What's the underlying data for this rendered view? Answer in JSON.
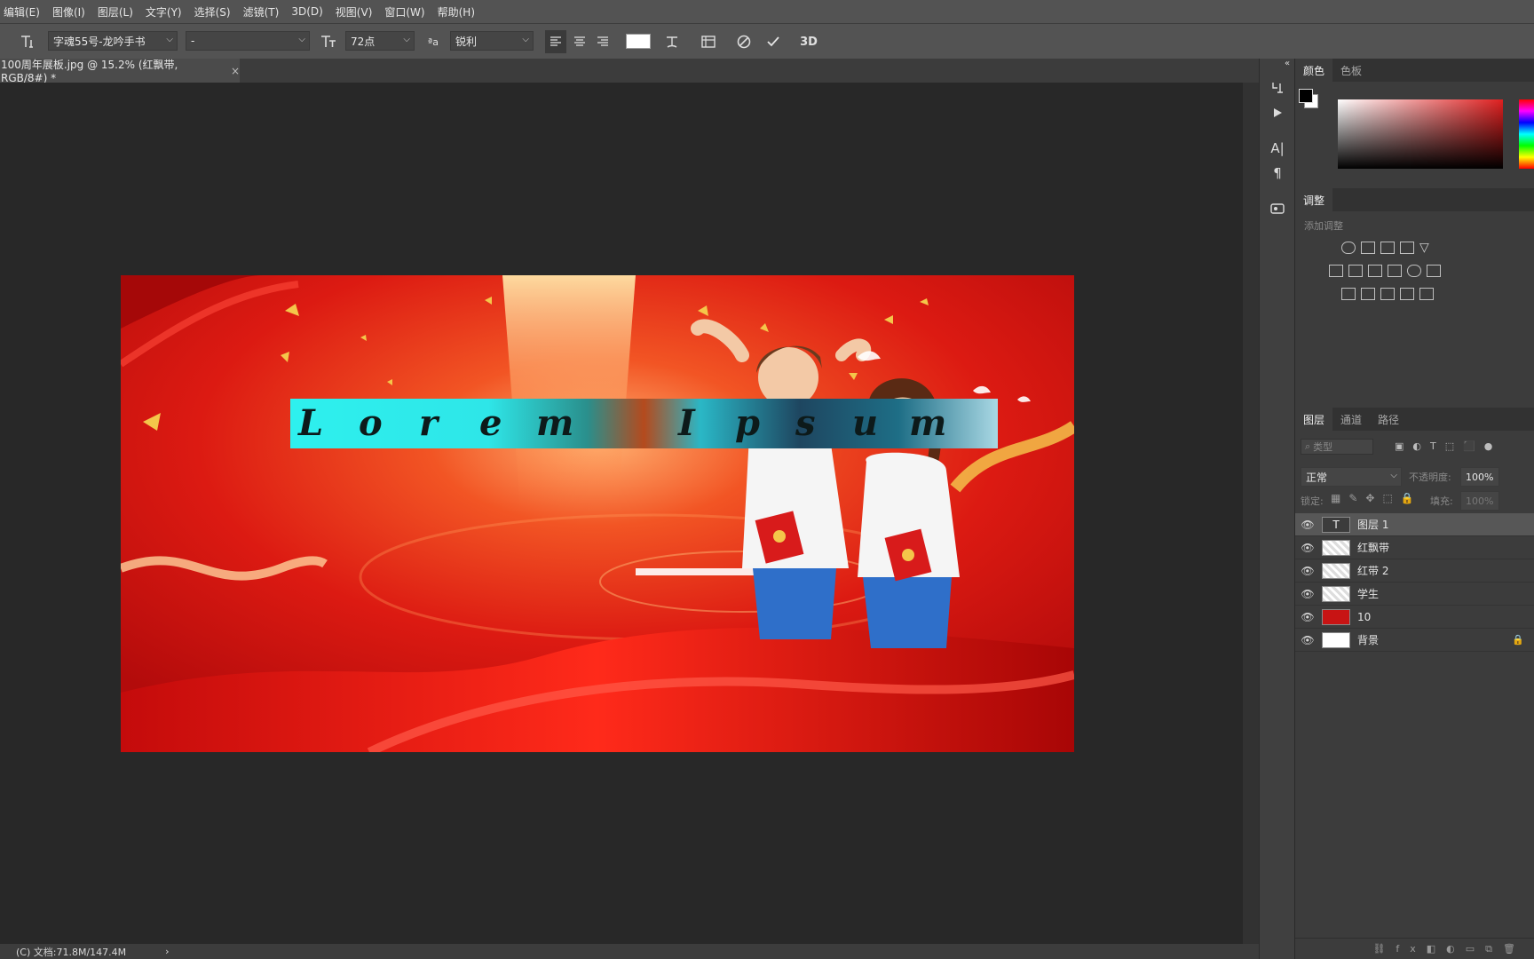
{
  "menubar": {
    "items": [
      "编辑(E)",
      "图像(I)",
      "图层(L)",
      "文字(Y)",
      "选择(S)",
      "滤镜(T)",
      "3D(D)",
      "视图(V)",
      "窗口(W)",
      "帮助(H)"
    ]
  },
  "options": {
    "font_family": "字魂55号-龙吟手书",
    "font_style": "-",
    "font_size": "72点",
    "aa_label": "ªa",
    "antialias": "锐利",
    "threed": "3D",
    "text_color": "#ffffff"
  },
  "document": {
    "tab_title": "100周年展板.jpg @ 15.2% (红飘带, RGB/8#) *",
    "close": "×",
    "status": "(C) 文档:71.8M/147.4M",
    "status_arrow": "›"
  },
  "canvas": {
    "text": "Lorem Ipsum",
    "text_letters": [
      "L",
      "o",
      "r",
      "e",
      "m",
      "I",
      "p",
      "s",
      "u",
      "m"
    ],
    "selection_color": "#2ef0ee",
    "bg_color": "#d8130f"
  },
  "color_panel": {
    "tabs": [
      "颜色",
      "色板"
    ],
    "foreground": "#000000",
    "background": "#ffffff"
  },
  "adjust_panel": {
    "tab": "调整",
    "subtitle": "添加调整"
  },
  "layers_panel": {
    "tabs": [
      "图层",
      "通道",
      "路径"
    ],
    "search_placeholder": "类型",
    "blend_mode": "正常",
    "opacity_label": "不透明度:",
    "opacity_value": "100%",
    "lock_label": "锁定:",
    "fill_label": "填充:",
    "fill_value": "100%",
    "layers": [
      {
        "name": "图层 1",
        "type": "text",
        "selected": true
      },
      {
        "name": "红飘带",
        "type": "smart",
        "selected": false
      },
      {
        "name": "红带 2",
        "type": "smart",
        "selected": false
      },
      {
        "name": "学生",
        "type": "smart",
        "selected": false
      },
      {
        "name": "10",
        "type": "smart-red",
        "selected": false
      },
      {
        "name": "背景",
        "type": "background",
        "selected": false,
        "locked": true
      }
    ]
  }
}
